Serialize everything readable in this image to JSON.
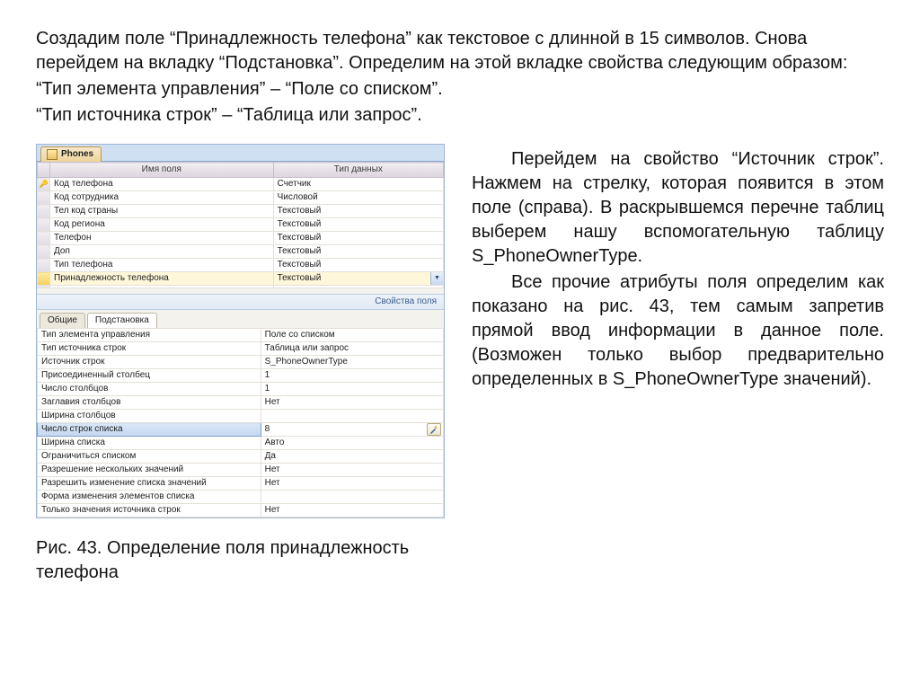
{
  "intro": {
    "p1": "Создадим поле “Принадлежность телефона” как текстовое с длинной в 15 символов.  Снова перейдем на вкладку “Подстановка”. Определим на этой вкладке свойства следующим образом:",
    "p2": "“Тип элемента управления” – “Поле со списком”.",
    "p3": "“Тип источника строк” – “Таблица или запрос”."
  },
  "right": {
    "p1": "Перейдем на свойство “Источник строк”. Нажмем на стрелку, которая появится в этом поле (справа). В раскрывшемся перечне таблиц выберем нашу вспомогательную таблицу S_PhoneOwnerType.",
    "p2": "Все прочие атрибуты поля определим как показано на рис. 43, тем самым запретив прямой ввод информации в данное поле. (Возможен только выбор предварительно определенных в S_PhoneOwnerType значений)."
  },
  "caption": "Рис. 43. Определение поля принадлежность телефона",
  "access": {
    "tab_label": "Phones",
    "col_name": "Имя поля",
    "col_type": "Тип данных",
    "props_title": "Свойства поля",
    "subtab_general": "Общие",
    "subtab_lookup": "Подстановка",
    "fields": [
      {
        "key": true,
        "name": "Код телефона",
        "type": "Счетчик",
        "selected": false
      },
      {
        "key": false,
        "name": "Код сотрудника",
        "type": "Числовой",
        "selected": false
      },
      {
        "key": false,
        "name": "Тел код страны",
        "type": "Текстовый",
        "selected": false
      },
      {
        "key": false,
        "name": "Код региона",
        "type": "Текстовый",
        "selected": false
      },
      {
        "key": false,
        "name": "Телефон",
        "type": "Текстовый",
        "selected": false
      },
      {
        "key": false,
        "name": "Доп",
        "type": "Текстовый",
        "selected": false
      },
      {
        "key": false,
        "name": "Тип телефона",
        "type": "Текстовый",
        "selected": false
      },
      {
        "key": false,
        "name": "Принадлежность телефона",
        "type": "Текстовый",
        "selected": true
      },
      {
        "key": false,
        "name": "",
        "type": "",
        "selected": false
      }
    ],
    "props": [
      {
        "label": "Тип элемента управления",
        "value": "Поле со списком",
        "sel": false
      },
      {
        "label": "Тип источника строк",
        "value": "Таблица или запрос",
        "sel": false
      },
      {
        "label": "Источник строк",
        "value": "S_PhoneOwnerType",
        "sel": false
      },
      {
        "label": "Присоединенный столбец",
        "value": "1",
        "sel": false
      },
      {
        "label": "Число столбцов",
        "value": "1",
        "sel": false
      },
      {
        "label": "Заглавия столбцов",
        "value": "Нет",
        "sel": false
      },
      {
        "label": "Ширина столбцов",
        "value": "",
        "sel": false
      },
      {
        "label": "Число строк списка",
        "value": "8",
        "sel": true
      },
      {
        "label": "Ширина списка",
        "value": "Авто",
        "sel": false
      },
      {
        "label": "Ограничиться списком",
        "value": "Да",
        "sel": false
      },
      {
        "label": "Разрешение нескольких значений",
        "value": "Нет",
        "sel": false
      },
      {
        "label": "Разрешить изменение списка значений",
        "value": "Нет",
        "sel": false
      },
      {
        "label": "Форма изменения элементов списка",
        "value": "",
        "sel": false
      },
      {
        "label": "Только значения источника строк",
        "value": "Нет",
        "sel": false
      }
    ]
  }
}
